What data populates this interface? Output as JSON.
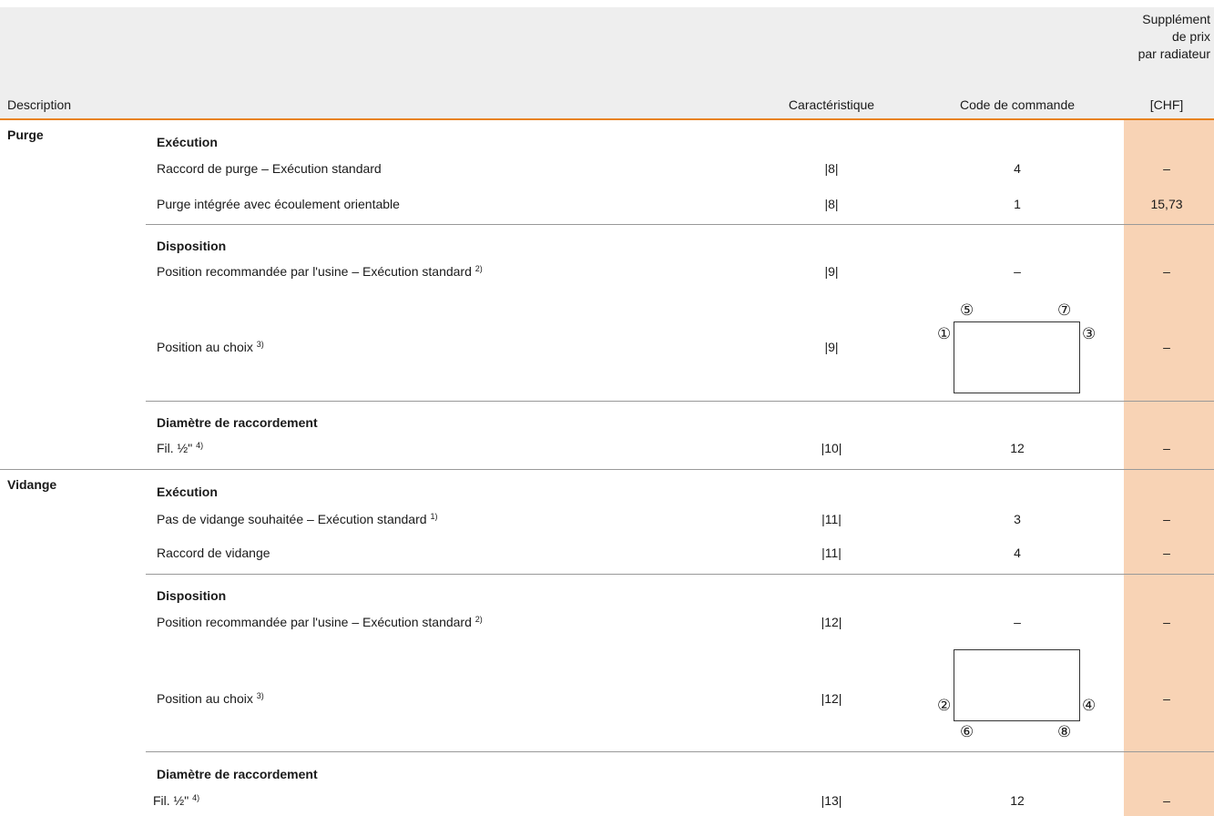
{
  "header": {
    "description": "Description",
    "characteristic": "Caractéristique",
    "order_code": "Code de commande",
    "surcharge_line1": "Supplément",
    "surcharge_line2": "de prix",
    "surcharge_line3": "par radiateur",
    "currency": "[CHF]"
  },
  "purge": {
    "title": "Purge",
    "execution": {
      "title": "Exécution",
      "rows": [
        {
          "label": "Raccord de purge – Exécution standard",
          "char": "|8|",
          "code": "4",
          "price": "–"
        },
        {
          "label": "Purge intégrée avec écoulement orientable",
          "char": "|8|",
          "code": "1",
          "price": "15,73"
        }
      ]
    },
    "disposition": {
      "title": "Disposition",
      "row1": {
        "label": "Position recommandée par l'usine – Exécution standard",
        "note": "2)",
        "char": "|9|",
        "code": "–",
        "price": "–"
      },
      "row2": {
        "label": "Position au choix",
        "note": "3)",
        "char": "|9|",
        "price": "–"
      },
      "diagram": {
        "top_left": "⑤",
        "top_right": "⑦",
        "left": "①",
        "right": "③"
      }
    },
    "diameter": {
      "title": "Diamètre de raccordement",
      "row": {
        "label": "Fil. ½\"",
        "note": "4)",
        "char": "|10|",
        "code": "12",
        "price": "–"
      }
    }
  },
  "drain": {
    "title": "Vidange",
    "execution": {
      "title": "Exécution",
      "rows": [
        {
          "label": "Pas de vidange souhaitée – Exécution standard",
          "note": "1)",
          "char": "|11|",
          "code": "3",
          "price": "–"
        },
        {
          "label": "Raccord de vidange",
          "char": "|11|",
          "code": "4",
          "price": "–"
        }
      ]
    },
    "disposition": {
      "title": "Disposition",
      "row1": {
        "label": "Position recommandée par l'usine – Exécution standard",
        "note": "2)",
        "char": "|12|",
        "code": "–",
        "price": "–"
      },
      "row2": {
        "label": "Position au choix",
        "note": "3)",
        "char": "|12|",
        "price": "–"
      },
      "diagram": {
        "left": "②",
        "right": "④",
        "bottom_left": "⑥",
        "bottom_right": "⑧"
      }
    },
    "diameter": {
      "title": "Diamètre de raccordement",
      "row": {
        "label": "Fil. ½\"",
        "note": "4)",
        "char": "|13|",
        "code": "12",
        "price": "–"
      }
    }
  },
  "colors": {
    "header_bg": "#eeeeee",
    "accent": "#e8821e",
    "price_bg": "#f8d3b5",
    "divider": "#999999"
  }
}
